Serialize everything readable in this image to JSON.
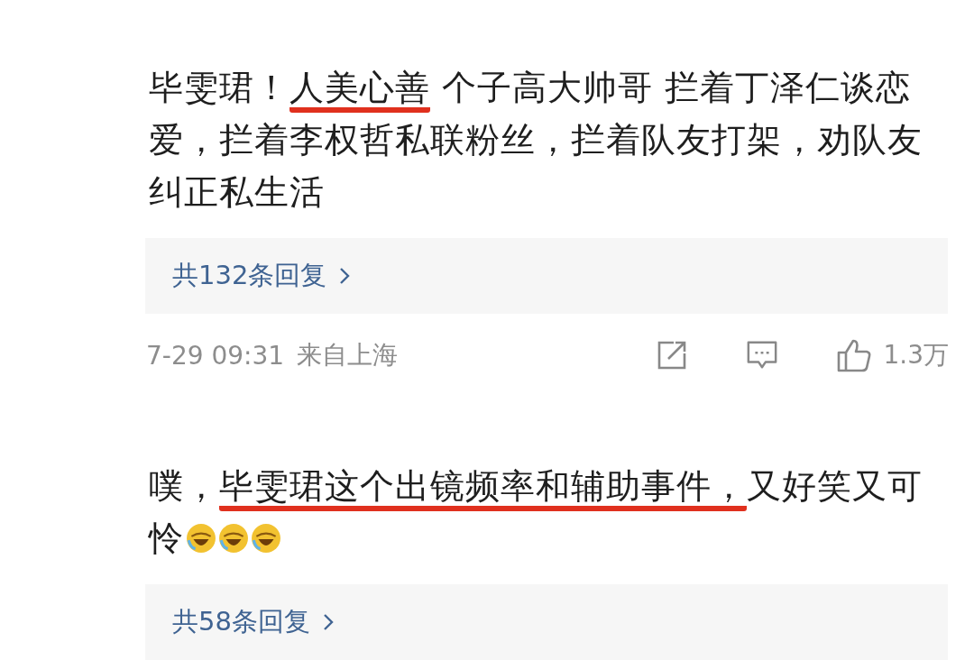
{
  "comments": [
    {
      "segments": [
        {
          "text": "毕雯珺！",
          "underlined": false
        },
        {
          "text": "人美心善",
          "underlined": true
        },
        {
          "text": " 个子高大帅哥  拦着丁泽仁谈恋爱，拦着李权哲私联粉丝，拦着队友打架，劝队友纠正私生活",
          "underlined": false
        }
      ],
      "replies": "共132条回复",
      "meta": {
        "time": "7-29 09:31",
        "location": "来自上海",
        "likes": "1.3万"
      }
    },
    {
      "segments": [
        {
          "text": "噗，",
          "underlined": false
        },
        {
          "text": "毕雯珺这个出镜频率和辅助事件，",
          "underlined": true
        },
        {
          "text": "又好笑又可怜",
          "underlined": false
        }
      ],
      "emojis": [
        {
          "kind": "laugh-cry"
        },
        {
          "kind": "laugh-cry"
        },
        {
          "kind": "laugh-cry"
        }
      ],
      "replies": "共58条回复"
    }
  ]
}
